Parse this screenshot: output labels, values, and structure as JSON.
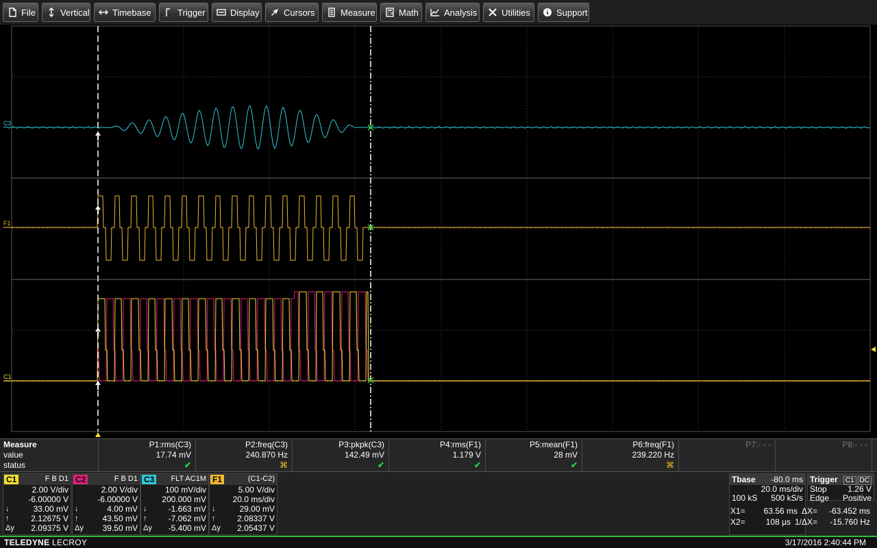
{
  "menu": [
    {
      "id": "file",
      "label": "File",
      "icon": "file-icon"
    },
    {
      "id": "vertical",
      "label": "Vertical",
      "icon": "vertical-arrows-icon"
    },
    {
      "id": "timebase",
      "label": "Timebase",
      "icon": "horizontal-arrows-icon"
    },
    {
      "id": "trigger",
      "label": "Trigger",
      "icon": "trigger-edge-icon"
    },
    {
      "id": "display",
      "label": "Display",
      "icon": "display-icon"
    },
    {
      "id": "cursors",
      "label": "Cursors",
      "icon": "cursor-icon"
    },
    {
      "id": "measure",
      "label": "Measure",
      "icon": "ruler-icon"
    },
    {
      "id": "math",
      "label": "Math",
      "icon": "calculator-icon"
    },
    {
      "id": "analysis",
      "label": "Analysis",
      "icon": "graph-icon"
    },
    {
      "id": "utilities",
      "label": "Utilities",
      "icon": "tools-icon"
    },
    {
      "id": "support",
      "label": "Support",
      "icon": "info-icon"
    }
  ],
  "trace_labels": {
    "c3": "C3",
    "f1": "F1",
    "c1": "C1"
  },
  "colors": {
    "c1": "#f0e030",
    "c2": "#e0207a",
    "c3": "#30c8d8",
    "f1": "#f0b830",
    "grid": "#555555",
    "ok": "#2fd33a"
  },
  "measure": {
    "labels": {
      "title": "Measure",
      "value": "value",
      "status": "status"
    },
    "params": [
      {
        "name": "P1:rms(C3)",
        "value": "17.74 mV",
        "status": "ok"
      },
      {
        "name": "P2:freq(C3)",
        "value": "240.870 Hz",
        "status": "warn"
      },
      {
        "name": "P3:pkpk(C3)",
        "value": "142.49 mV",
        "status": "ok"
      },
      {
        "name": "P4:rms(F1)",
        "value": "1.179 V",
        "status": "ok"
      },
      {
        "name": "P5:mean(F1)",
        "value": "28 mV",
        "status": "ok"
      },
      {
        "name": "P6:freq(F1)",
        "value": "239.220 Hz",
        "status": "warn"
      },
      {
        "name": "P7:- - -",
        "value": "",
        "status": ""
      },
      {
        "name": "P8:- - -",
        "value": "",
        "status": ""
      }
    ],
    "ok_symbol": "✔",
    "warn_symbol": "⌘"
  },
  "channels": [
    {
      "tag": "C1",
      "info": "F B D1",
      "color": "#f0e030",
      "scale": "2.00 V/div",
      "offset": "-6.00000 V",
      "down": "33.00 mV",
      "up": "2.12675 V",
      "delta": "2.09375 V"
    },
    {
      "tag": "C2",
      "info": "F B D1",
      "color": "#e0207a",
      "scale": "2.00 V/div",
      "offset": "-6.00000 V",
      "down": "4.00 mV",
      "up": "43.50 mV",
      "delta": "39.50 mV"
    },
    {
      "tag": "C3",
      "info": "FLT AC1M",
      "color": "#30c8d8",
      "scale": "100 mV/div",
      "offset": "200.000 mV",
      "down": "-1.663 mV",
      "up": "-7.062 mV",
      "delta": "-5.400 mV"
    },
    {
      "tag": "F1",
      "info": "(C1-C2)",
      "color": "#f0b830",
      "scale": "5.00 V/div",
      "offset": "20.0 ms/div",
      "down": "29.00 mV",
      "up": "2.08337 V",
      "delta": "2.05437 V"
    }
  ],
  "cursor_glyphs": {
    "down": "↓",
    "up": "↑",
    "delta": "Δy"
  },
  "timebase": {
    "title": "Tbase",
    "delay": "-80.0 ms",
    "scale": "20.0 ms/div",
    "samples": "100 kS",
    "rate": "500 kS/s"
  },
  "trigger": {
    "title": "Trigger",
    "source": "C1",
    "coupling": "DC",
    "mode": "Stop",
    "level": "1.26 V",
    "type": "Edge",
    "slope": "Positive"
  },
  "cursors": {
    "x1_label": "X1=",
    "x1": "63.56 ms",
    "dx_label": "ΔX=",
    "dx": "-63.452 ms",
    "x2_label": "X2=",
    "x2": "108 µs",
    "inv_label": "1/ΔX=",
    "inv": "-15.760 Hz"
  },
  "status": {
    "brand_bold": "TELEDYNE",
    "brand_rest": " LECROY",
    "datetime": "3/17/2016 2:40:44 PM"
  }
}
